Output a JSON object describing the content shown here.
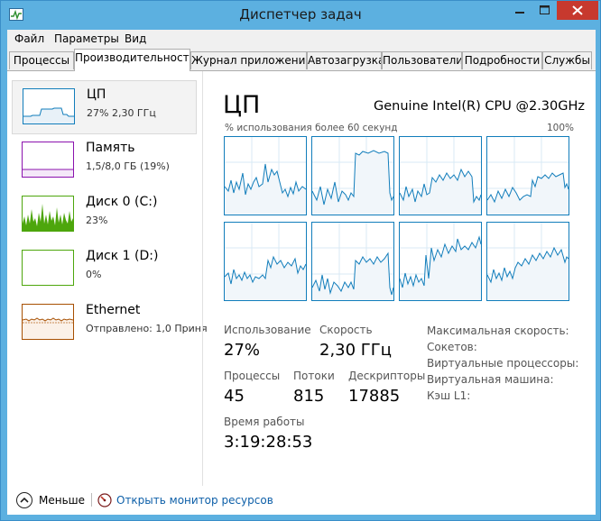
{
  "window": {
    "title": "Диспетчер задач"
  },
  "menu": [
    "Файл",
    "Параметры",
    "Вид"
  ],
  "tabs": [
    "Процессы",
    "Производительность",
    "Журнал приложений",
    "Автозагрузка",
    "Пользователи",
    "Подробности",
    "Службы"
  ],
  "sidebar": {
    "items": [
      {
        "title": "ЦП",
        "subtitle": "27% 2,30 ГГц",
        "color": "#117dbb"
      },
      {
        "title": "Память",
        "subtitle": "1,5/8,0 ГБ (19%)",
        "color": "#8b12ae"
      },
      {
        "title": "Диск 0 (C:)",
        "subtitle": "23%",
        "color": "#4da60c"
      },
      {
        "title": "Диск 1 (D:)",
        "subtitle": "0%",
        "color": "#4da60c"
      },
      {
        "title": "Ethernet",
        "subtitle": "Отправлено: 1,0 Приня",
        "color": "#a74f01"
      }
    ]
  },
  "main": {
    "title": "ЦП",
    "cpu_name": "Genuine Intel(R) CPU @2.30GHz",
    "graph_caption": "% использования более 60 секунд",
    "graph_max": "100%"
  },
  "stats": {
    "usage_label": "Использование",
    "usage_value": "27%",
    "speed_label": "Скорость",
    "speed_value": "2,30 ГГц",
    "processes_label": "Процессы",
    "processes_value": "45",
    "threads_label": "Потоки",
    "threads_value": "815",
    "handles_label": "Дескрипторы",
    "handles_value": "17885",
    "uptime_label": "Время работы",
    "uptime_value": "3:19:28:53"
  },
  "details": {
    "max_speed_label": "Максимальная скорость:",
    "sockets_label": "Сокетов:",
    "virtual_processors_label": "Виртуальные процессоры:",
    "virtual_machine_label": "Виртуальная машина:",
    "l1_cache_label": "Кэш L1:"
  },
  "footer": {
    "less_label": "Меньше",
    "resource_monitor_link": "Открыть монитор ресурсов"
  },
  "colors": {
    "cpu_line": "#117dbb",
    "cpu_fill": "#f1f6fa",
    "grid": "#d9eaf4",
    "window_frame": "#5cb0e0",
    "close_button": "#c7392e"
  },
  "icons": {
    "app": "task-manager-icon",
    "minimize": "minimize-icon",
    "maximize": "maximize-icon",
    "close": "close-icon",
    "less": "chevron-up-icon",
    "resource_monitor": "resource-monitor-icon"
  }
}
